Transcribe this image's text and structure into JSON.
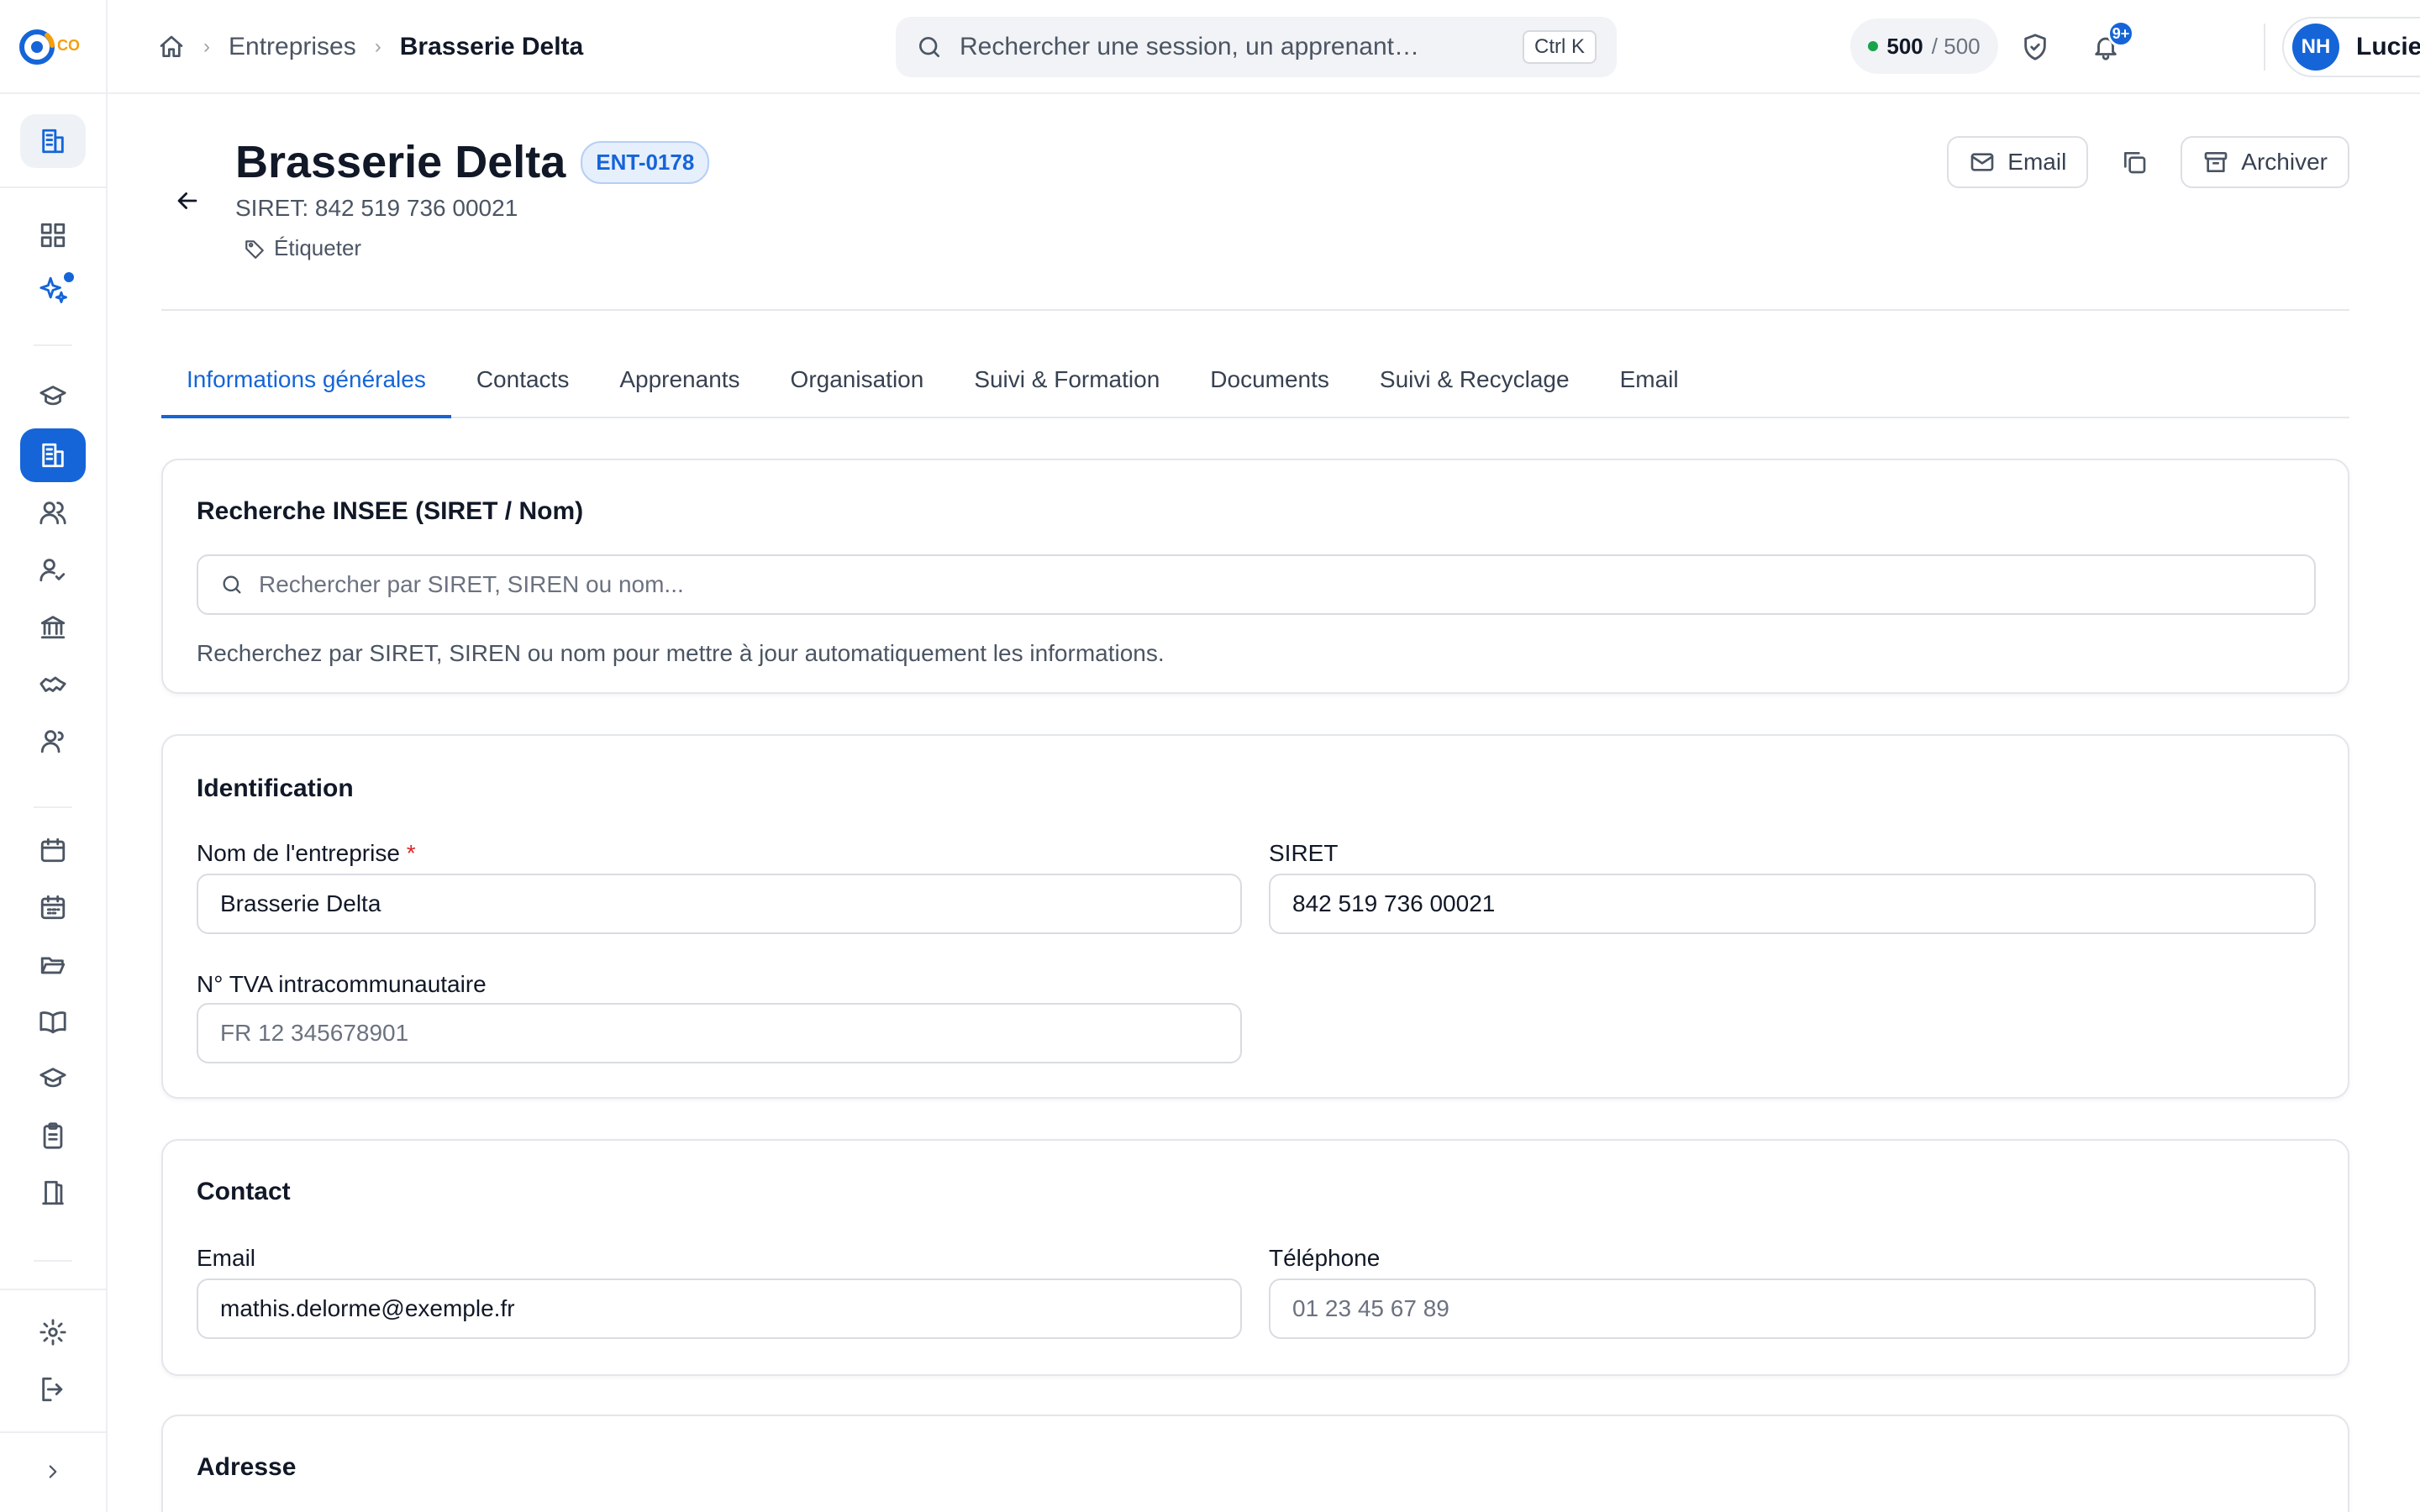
{
  "app": {
    "logo_text": "CO"
  },
  "breadcrumb": {
    "section": "Entreprises",
    "current": "Brasserie Delta"
  },
  "search": {
    "placeholder": "Rechercher une session, un apprenant…",
    "shortcut": "Ctrl K"
  },
  "credits": {
    "used": "500",
    "total": "/ 500",
    "status_color": "#16a34a"
  },
  "notifications": {
    "badge": "9+"
  },
  "user": {
    "initials": "NH",
    "name": "Lucie"
  },
  "company": {
    "name": "Brasserie Delta",
    "code": "ENT-0178",
    "siret_line": "SIRET: 842 519 736 00021",
    "tag_label": "Étiqueter"
  },
  "actions": {
    "email": "Email",
    "archive": "Archiver"
  },
  "tabs": [
    {
      "label": "Informations générales",
      "active": true
    },
    {
      "label": "Contacts"
    },
    {
      "label": "Apprenants"
    },
    {
      "label": "Organisation"
    },
    {
      "label": "Suivi & Formation"
    },
    {
      "label": "Documents"
    },
    {
      "label": "Suivi & Recyclage"
    },
    {
      "label": "Email"
    }
  ],
  "insee": {
    "title": "Recherche INSEE (SIRET / Nom)",
    "placeholder": "Rechercher par SIRET, SIREN ou nom...",
    "hint": "Recherchez par SIRET, SIREN ou nom pour mettre à jour automatiquement les informations."
  },
  "identification": {
    "title": "Identification",
    "name_label": "Nom de l'entreprise",
    "required_mark": "*",
    "name_value": "Brasserie Delta",
    "siret_label": "SIRET",
    "siret_value": "842 519 736 00021",
    "tva_label": "N° TVA intracommunautaire",
    "tva_placeholder": "FR 12 345678901"
  },
  "contact": {
    "title": "Contact",
    "email_label": "Email",
    "email_value": "mathis.delorme@exemple.fr",
    "phone_label": "Téléphone",
    "phone_placeholder": "01 23 45 67 89"
  },
  "address": {
    "title": "Adresse"
  },
  "theme": {
    "accent": "#1565d8",
    "required": "#dc2626"
  }
}
